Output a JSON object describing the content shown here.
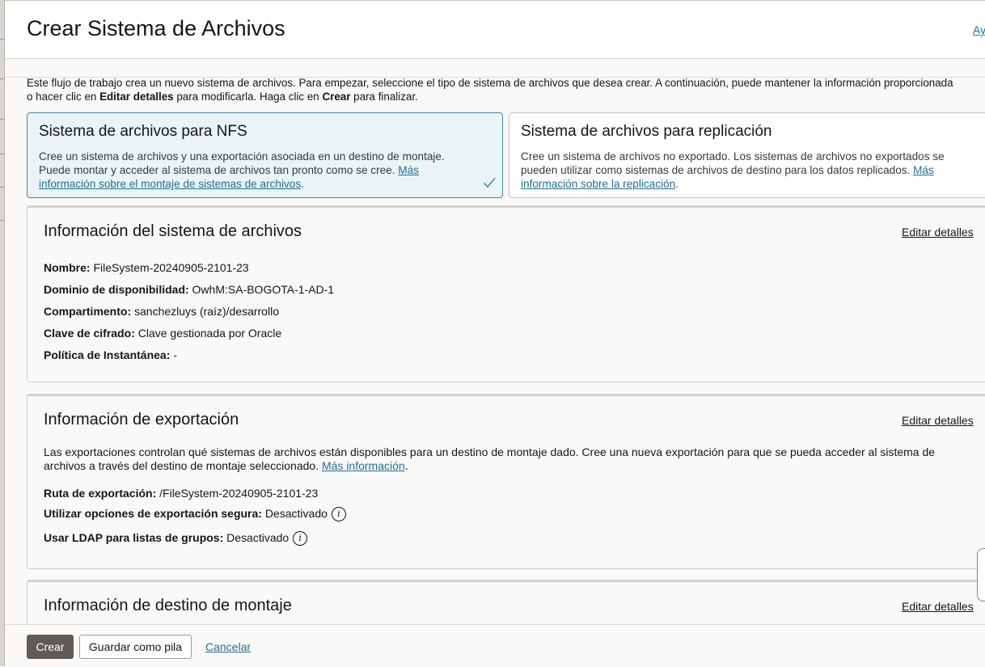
{
  "header": {
    "title": "Crear Sistema de Archivos",
    "help_label": "Ay"
  },
  "intro": {
    "text_1": "Este flujo de trabajo crea un nuevo sistema de archivos. Para empezar, seleccione el tipo de sistema de archivos que desea crear. A continuación, puede mantener la información proporcionada o hacer clic en ",
    "bold_1": "Editar detalles",
    "text_2": " para modificarla. Haga clic en ",
    "bold_2": "Crear",
    "text_3": " para finalizar."
  },
  "type_cards": [
    {
      "title": "Sistema de archivos para NFS",
      "desc": "Cree un sistema de archivos y una exportación asociada en un destino de montaje. Puede montar y acceder al sistema de archivos tan pronto como se cree. ",
      "link": "Más información sobre el montaje de sistemas de archivos",
      "suffix": ".",
      "selected": true
    },
    {
      "title": "Sistema de archivos para replicación",
      "desc": "Cree un sistema de archivos no exportado. Los sistemas de archivos no exportados se pueden utilizar como sistemas de archivos de destino para los datos replicados. ",
      "link": "Más información sobre la replicación",
      "suffix": ".",
      "selected": false
    }
  ],
  "filesystem_info": {
    "title": "Información del sistema de archivos",
    "edit_label": "Editar detalles",
    "fields": [
      {
        "label": "Nombre:",
        "value": "FileSystem-20240905-2101-23"
      },
      {
        "label": "Dominio de disponibilidad:",
        "value": "OwhM:SA-BOGOTA-1-AD-1"
      },
      {
        "label": "Compartimento:",
        "value": "sanchezluys (raíz)/desarrollo"
      },
      {
        "label": "Clave de cifrado:",
        "value": "Clave gestionada por Oracle"
      },
      {
        "label": "Política de Instantánea:",
        "value": "-"
      }
    ]
  },
  "export_info": {
    "title": "Información de exportación",
    "edit_label": "Editar detalles",
    "desc": "Las exportaciones controlan qué sistemas de archivos están disponibles para un destino de montaje dado. Cree una nueva exportación para que se pueda acceder al sistema de archivos a través del destino de montaje seleccionado. ",
    "desc_link": "Más información",
    "desc_suffix": ".",
    "fields": [
      {
        "label": "Ruta de exportación:",
        "value": "/FileSystem-20240905-2101-23"
      },
      {
        "label": "Utilizar opciones de exportación segura:",
        "value": "Desactivado"
      },
      {
        "label": "Usar LDAP para listas de grupos:",
        "value": "Desactivado"
      }
    ]
  },
  "mount_info": {
    "title": "Información de destino de montaje",
    "edit_label": "Editar detalles"
  },
  "footer": {
    "create_label": "Crear",
    "save_stack_label": "Guardar como pila",
    "cancel_label": "Cancelar"
  },
  "icons": {
    "info": "info-icon",
    "check": "check-icon"
  },
  "colors": {
    "primary_button": "#5f5a56",
    "link": "#1f6f8f",
    "selected_card_bg": "#eaf4f6",
    "selected_card_border": "#3a8aa3"
  }
}
